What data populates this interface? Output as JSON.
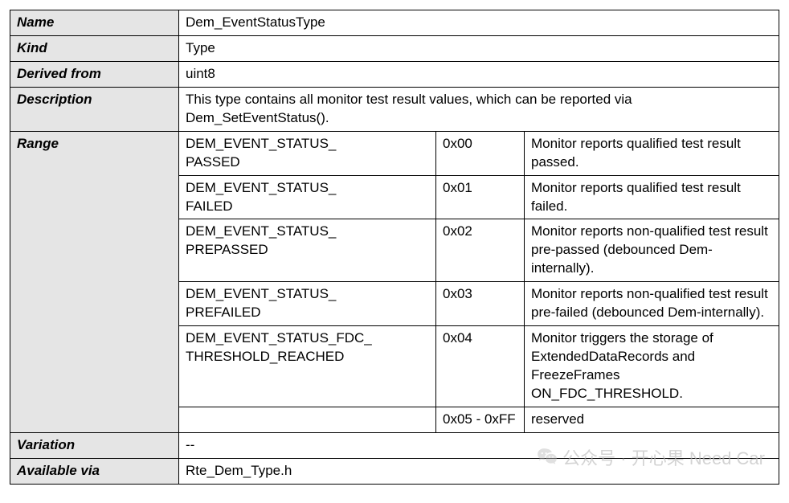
{
  "labels": {
    "name": "Name",
    "kind": "Kind",
    "derived": "Derived from",
    "description": "Description",
    "range": "Range",
    "variation": "Variation",
    "available": "Available via"
  },
  "values": {
    "name": "Dem_EventStatusType",
    "kind": "Type",
    "derived": "uint8",
    "description": "This type contains all monitor test result values, which can be reported via Dem_SetEventStatus().",
    "variation": "--",
    "available": "Rte_Dem_Type.h"
  },
  "range": [
    {
      "enum": "DEM_EVENT_STATUS_\nPASSED",
      "val": "0x00",
      "desc": "Monitor reports qualified test result passed."
    },
    {
      "enum": "DEM_EVENT_STATUS_\nFAILED",
      "val": "0x01",
      "desc": "Monitor reports qualified test result failed."
    },
    {
      "enum": "DEM_EVENT_STATUS_\nPREPASSED",
      "val": "0x02",
      "desc": "Monitor reports non-qualified test result pre-passed (debounced Dem-internally)."
    },
    {
      "enum": "DEM_EVENT_STATUS_\nPREFAILED",
      "val": "0x03",
      "desc": "Monitor reports non-qualified test result pre-failed (debounced Dem-internally)."
    },
    {
      "enum": "DEM_EVENT_STATUS_FDC_\nTHRESHOLD_REACHED",
      "val": "0x04",
      "desc": "Monitor triggers the storage of ExtendedDataRecords and FreezeFrames ON_FDC_THRESHOLD."
    },
    {
      "enum": "",
      "val": "0x05 - 0xFF",
      "desc": "reserved"
    }
  ],
  "watermark": "公众号 · 开心果 Need Car"
}
